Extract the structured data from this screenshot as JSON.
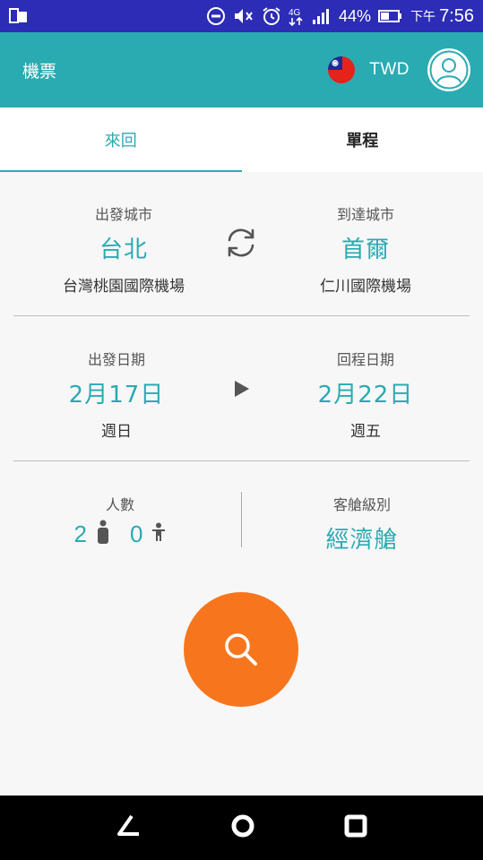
{
  "status_bar": {
    "battery": "44%",
    "ampm": "下午",
    "time": "7:56",
    "network": "4G"
  },
  "app_bar": {
    "title": "機票",
    "currency": "TWD",
    "flag_icon": "taiwan-flag-icon",
    "avatar_icon": "user-avatar-icon"
  },
  "tabs": [
    {
      "label": "來回",
      "active": true
    },
    {
      "label": "單程",
      "active": false
    }
  ],
  "route": {
    "departure_label": "出發城市",
    "departure_city": "台北",
    "departure_airport": "台灣桃園國際機場",
    "arrival_label": "到達城市",
    "arrival_city": "首爾",
    "arrival_airport": "仁川國際機場"
  },
  "dates": {
    "depart_label": "出發日期",
    "depart_date": "2月17日",
    "depart_weekday": "週日",
    "return_label": "回程日期",
    "return_date": "2月22日",
    "return_weekday": "週五"
  },
  "passengers": {
    "label": "人數",
    "adults": "2",
    "children": "0"
  },
  "cabin": {
    "label": "客艙級別",
    "value": "經濟艙"
  },
  "colors": {
    "status_bar": "#2c2cb6",
    "accent": "#29abb1",
    "search_button": "#f7761d"
  }
}
